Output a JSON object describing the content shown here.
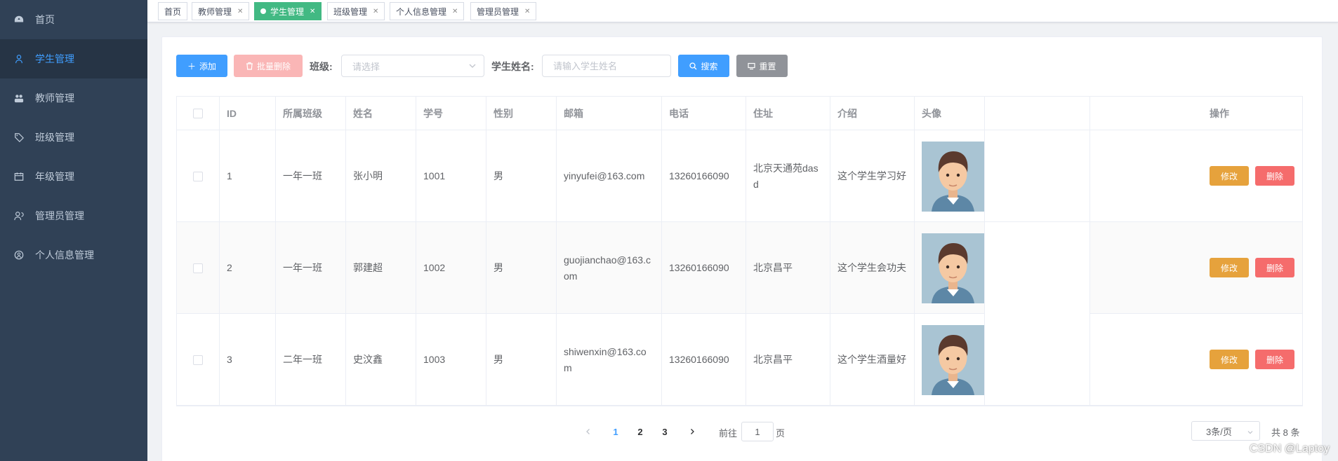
{
  "sidebar": {
    "items": [
      {
        "label": "首页",
        "icon": "dashboard-icon",
        "active": false
      },
      {
        "label": "学生管理",
        "icon": "user-icon",
        "active": true
      },
      {
        "label": "教师管理",
        "icon": "peoples-icon",
        "active": false
      },
      {
        "label": "班级管理",
        "icon": "tag-icon",
        "active": false
      },
      {
        "label": "年级管理",
        "icon": "calendar-icon",
        "active": false
      },
      {
        "label": "管理员管理",
        "icon": "admin-icon",
        "active": false
      },
      {
        "label": "个人信息管理",
        "icon": "profile-icon",
        "active": false
      }
    ]
  },
  "tags": [
    {
      "label": "首页",
      "closable": false,
      "active": false
    },
    {
      "label": "教师管理",
      "closable": true,
      "active": false
    },
    {
      "label": "学生管理",
      "closable": true,
      "active": true
    },
    {
      "label": "班级管理",
      "closable": true,
      "active": false
    },
    {
      "label": "个人信息管理",
      "closable": true,
      "active": false
    },
    {
      "label": "管理员管理",
      "closable": true,
      "active": false
    }
  ],
  "toolbar": {
    "add_label": "添加",
    "batch_delete_label": "批量删除",
    "class_label": "班级:",
    "class_placeholder": "请选择",
    "name_label": "学生姓名:",
    "name_placeholder": "请输入学生姓名",
    "search_label": "搜索",
    "reset_label": "重置"
  },
  "table": {
    "headers": [
      "ID",
      "所属班级",
      "姓名",
      "学号",
      "性别",
      "邮箱",
      "电话",
      "住址",
      "介绍",
      "头像",
      "操作"
    ],
    "rows": [
      {
        "id": "1",
        "class": "一年一班",
        "name": "张小明",
        "no": "1001",
        "gender": "男",
        "email": "yinyufei@163.com",
        "phone": "13260166090",
        "address": "北京天通苑dasd",
        "intro": "这个学生学习好"
      },
      {
        "id": "2",
        "class": "一年一班",
        "name": "郭建超",
        "no": "1002",
        "gender": "男",
        "email": "guojianchao@163.com",
        "phone": "13260166090",
        "address": "北京昌平",
        "intro": "这个学生会功夫"
      },
      {
        "id": "3",
        "class": "二年一班",
        "name": "史汶鑫",
        "no": "1003",
        "gender": "男",
        "email": "shiwenxin@163.com",
        "phone": "13260166090",
        "address": "北京昌平",
        "intro": "这个学生酒量好"
      }
    ],
    "edit_label": "修改",
    "delete_label": "删除"
  },
  "pagination": {
    "pages": [
      "1",
      "2",
      "3"
    ],
    "current": "1",
    "goto_prefix": "前往",
    "goto_value": "1",
    "goto_suffix": "页",
    "page_size": "3条/页",
    "total": "共 8 条"
  },
  "watermark": "CSDN @Laptoy",
  "colors": {
    "sidebar_bg": "#304156",
    "active_menu": "#409eff",
    "active_tag": "#42b983",
    "edit": "#e6a23c",
    "delete": "#f56c6c"
  }
}
